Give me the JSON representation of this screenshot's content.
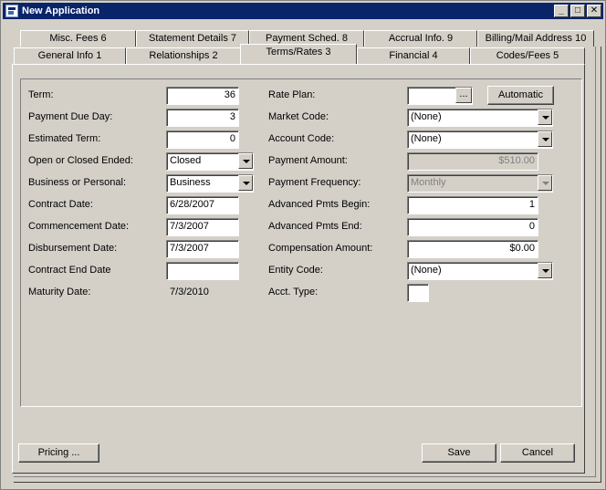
{
  "window": {
    "title": "New Application",
    "minimize": "_",
    "maximize": "□",
    "close": "✕"
  },
  "tabs_back": [
    {
      "label": "Misc. Fees 6"
    },
    {
      "label": "Statement Details 7"
    },
    {
      "label": "Payment Sched. 8"
    },
    {
      "label": "Accrual Info. 9"
    },
    {
      "label": "Billing/Mail Address 10"
    }
  ],
  "tabs_front": [
    {
      "label": "General Info 1"
    },
    {
      "label": "Relationships 2"
    },
    {
      "label": "Terms/Rates 3",
      "active": true
    },
    {
      "label": "Financial 4"
    },
    {
      "label": "Codes/Fees 5"
    }
  ],
  "left": {
    "term_label": "Term:",
    "term_value": "36",
    "payment_due_day_label": "Payment Due Day:",
    "payment_due_day_value": "3",
    "estimated_term_label": "Estimated Term:",
    "estimated_term_value": "0",
    "open_closed_label": "Open or Closed Ended:",
    "open_closed_value": "Closed",
    "business_personal_label": "Business or Personal:",
    "business_personal_value": "Business",
    "contract_date_label": "Contract Date:",
    "contract_date_value": "6/28/2007",
    "commencement_date_label": "Commencement Date:",
    "commencement_date_value": "7/3/2007",
    "disbursement_date_label": "Disbursement Date:",
    "disbursement_date_value": "7/3/2007",
    "contract_end_date_label": "Contract End Date",
    "contract_end_date_value": "",
    "maturity_date_label": "Maturity Date:",
    "maturity_date_value": "7/3/2010"
  },
  "right": {
    "rate_plan_label": "Rate Plan:",
    "rate_plan_value": "",
    "rate_plan_ellipsis": "...",
    "automatic_button": "Automatic",
    "market_code_label": "Market Code:",
    "market_code_value": "(None)",
    "account_code_label": "Account Code:",
    "account_code_value": "(None)",
    "payment_amount_label": "Payment Amount:",
    "payment_amount_value": "$510.00",
    "payment_frequency_label": "Payment Frequency:",
    "payment_frequency_value": "Monthly",
    "advanced_pmts_begin_label": "Advanced Pmts Begin:",
    "advanced_pmts_begin_value": "1",
    "advanced_pmts_end_label": "Advanced Pmts End:",
    "advanced_pmts_end_value": "0",
    "compensation_amount_label": "Compensation Amount:",
    "compensation_amount_value": "$0.00",
    "entity_code_label": "Entity Code:",
    "entity_code_value": "(None)",
    "acct_type_label": "Acct. Type:",
    "acct_type_value": ""
  },
  "footer": {
    "pricing_button": "Pricing ...",
    "save_button": "Save",
    "cancel_button": "Cancel"
  },
  "colors": {
    "titlebar": "#0a246a",
    "face": "#d4d0c8"
  }
}
